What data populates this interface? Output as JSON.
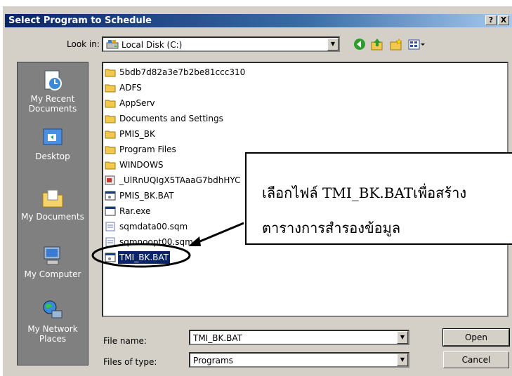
{
  "window": {
    "title": "Select Program to Schedule",
    "help_label": "?",
    "close_label": "X"
  },
  "lookin": {
    "label": "Look in:",
    "value": "Local Disk (C:)"
  },
  "places": [
    {
      "label": "My Recent Documents",
      "icon": "recent-documents-icon"
    },
    {
      "label": "Desktop",
      "icon": "desktop-icon"
    },
    {
      "label": "My Documents",
      "icon": "my-documents-icon"
    },
    {
      "label": "My Computer",
      "icon": "my-computer-icon"
    },
    {
      "label": "My Network Places",
      "icon": "network-places-icon"
    }
  ],
  "files": [
    {
      "name": "5bdb7d82a3e7b2be81ccc310",
      "type": "folder"
    },
    {
      "name": "ADFS",
      "type": "folder"
    },
    {
      "name": "AppServ",
      "type": "folder"
    },
    {
      "name": "Documents and Settings",
      "type": "folder"
    },
    {
      "name": "PMIS_BK",
      "type": "folder"
    },
    {
      "name": "Program Files",
      "type": "folder"
    },
    {
      "name": "WINDOWS",
      "type": "folder"
    },
    {
      "name": "_UlRnUQIgX5TAaaG7bdhHYC",
      "type": "installer"
    },
    {
      "name": "PMIS_BK.BAT",
      "type": "batch"
    },
    {
      "name": "Rar.exe",
      "type": "exe"
    },
    {
      "name": "sqmdata00.sqm",
      "type": "sqm"
    },
    {
      "name": "sqmnoopt00.sqm",
      "type": "sqm"
    },
    {
      "name": "TMI_BK.BAT",
      "type": "batch",
      "selected": true
    }
  ],
  "filename": {
    "label": "File name:",
    "value": "TMI_BK.BAT"
  },
  "filetype": {
    "label": "Files of type:",
    "value": "Programs"
  },
  "buttons": {
    "open": "Open",
    "cancel": "Cancel"
  },
  "annotation": {
    "line1": "เลือกไฟล์ TMI_BK.BATเพื่อสร้าง",
    "line2": "ตารางการสำรองข้อมูล"
  }
}
